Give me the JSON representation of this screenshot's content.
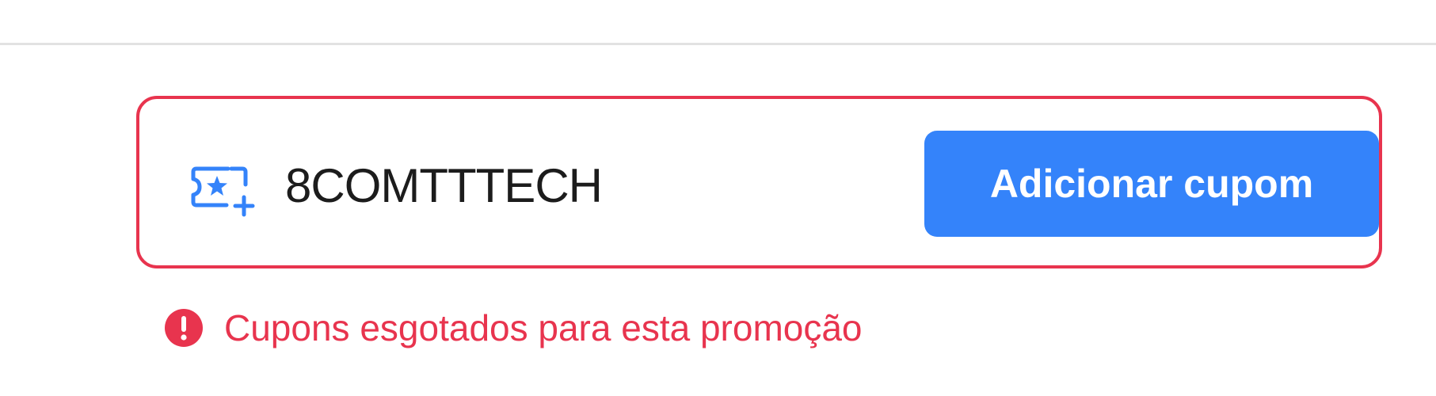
{
  "coupon": {
    "code_value": "8COMTTTECH",
    "icon": "coupon-star-plus-icon",
    "add_button_label": "Adicionar cupom",
    "error_icon": "exclamation-circle-icon",
    "error_message": "Cupons esgotados para esta promoção"
  },
  "colors": {
    "error": "#e8344e",
    "accent": "#3483fa",
    "divider": "#e2e2e2"
  }
}
